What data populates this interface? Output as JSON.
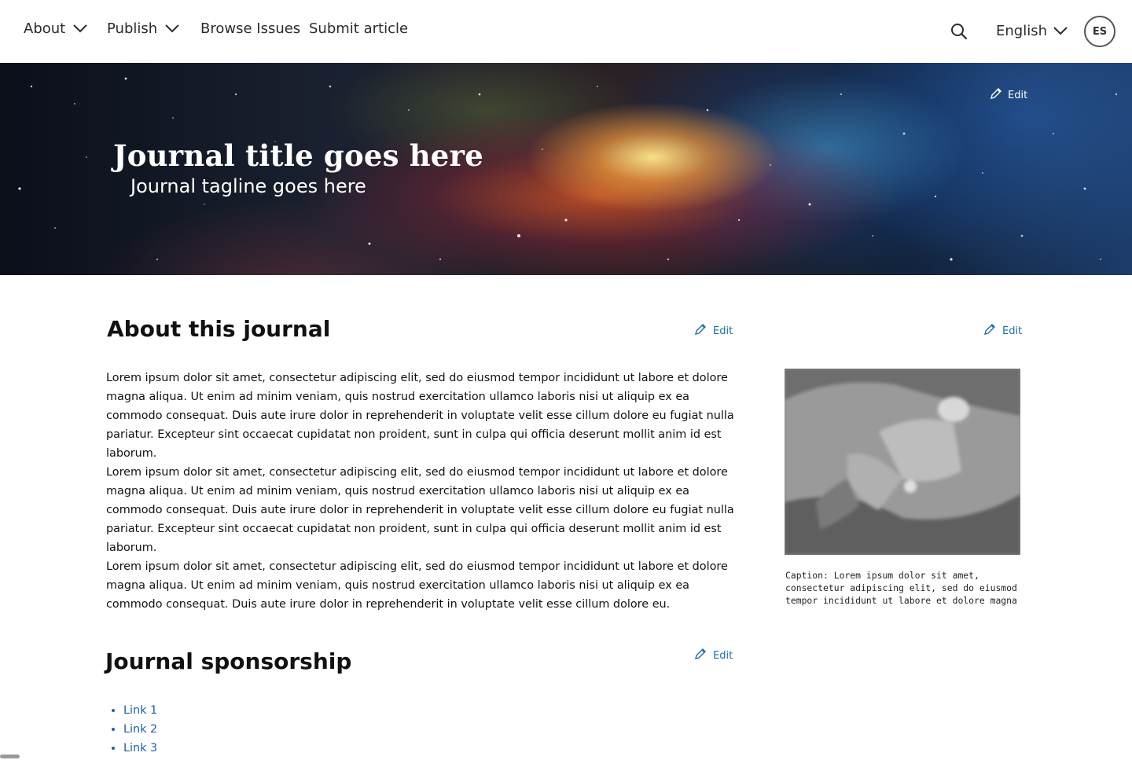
{
  "nav": {
    "about": "About",
    "publish": "Publish",
    "browse": "Browse Issues",
    "submit": "Submit article",
    "language": "English",
    "user_initials": "ES"
  },
  "hero": {
    "edit_label": "Edit",
    "title": "Journal title goes here",
    "tagline": "Journal tagline goes here"
  },
  "about": {
    "heading": "About this journal",
    "edit_label": "Edit",
    "paragraphs": [
      "Lorem ipsum dolor sit amet, consectetur adipiscing elit, sed do eiusmod  tempor incididunt ut labore et dolore magna aliqua. Ut enim ad minim  veniam, quis nostrud exercitation ullamco laboris nisi ut aliquip ex ea  commodo consequat. Duis aute irure dolor in reprehenderit in voluptate  velit esse cillum dolore eu fugiat nulla pariatur. Excepteur sint occaecat cupidatat non proident, sunt in culpa qui officia deserunt  mollit anim id est laborum.",
      "Lorem ipsum dolor sit amet, consectetur adipiscing elit, sed do eiusmod  tempor incididunt ut labore et dolore magna aliqua. Ut enim ad minim  veniam, quis nostrud exercitation ullamco laboris nisi ut aliquip ex ea  commodo consequat. Duis aute irure dolor in reprehenderit in voluptate  velit esse cillum dolore eu fugiat nulla pariatur. Excepteur sint occaecat cupidatat non proident, sunt in culpa qui officia deserunt  mollit anim id est laborum.",
      "Lorem ipsum dolor sit amet, consectetur adipiscing elit, sed do eiusmod  tempor incididunt ut labore et dolore magna aliqua. Ut enim ad minim  veniam, quis nostrud exercitation ullamco laboris nisi ut aliquip ex ea  commodo consequat. Duis aute irure dolor in reprehenderit in voluptate  velit esse cillum dolore eu."
    ]
  },
  "image_block": {
    "edit_label": "Edit",
    "caption": "Caption: Lorem ipsum dolor sit amet, consectetur adipiscing elit, sed do eiusmod  tempor incididunt ut labore et dolore magna"
  },
  "sponsorship": {
    "heading": "Journal sponsorship",
    "edit_label": "Edit",
    "links": [
      "Link 1",
      "Link 2",
      "Link 3"
    ]
  },
  "colors": {
    "link": "#1f5fae",
    "edit": "#1d6f9e",
    "text": "#111111"
  },
  "icons": {
    "nav_dropdown": "chevron-down-icon",
    "search": "search-icon",
    "edit": "pencil-icon"
  }
}
